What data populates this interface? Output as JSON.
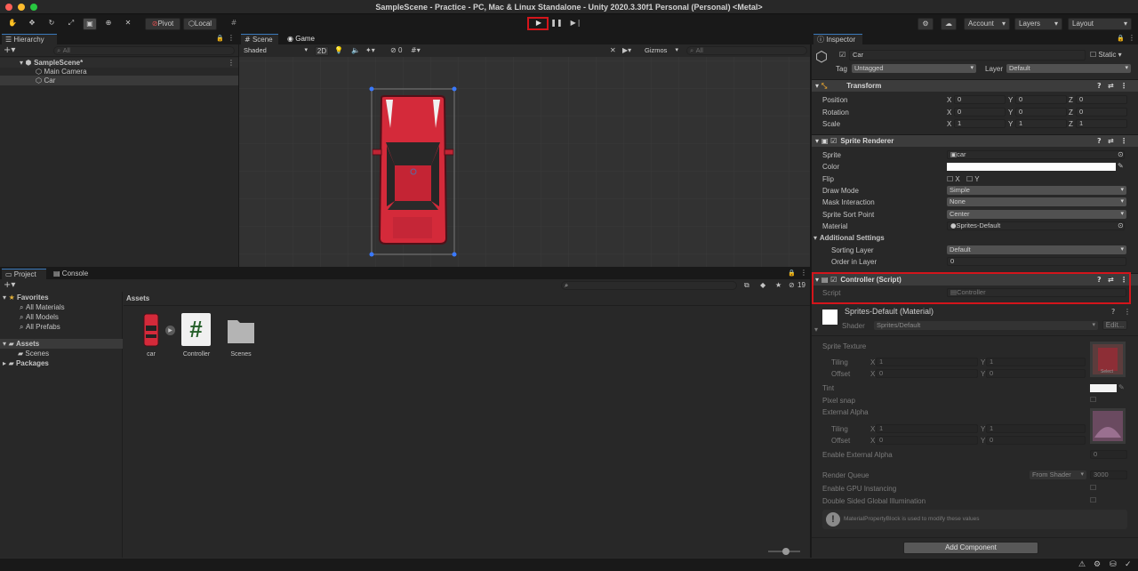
{
  "window": {
    "title": "SampleScene - Practice - PC, Mac & Linux Standalone - Unity 2020.3.30f1 Personal (Personal) <Metal>"
  },
  "toolbar": {
    "pivot": "Pivot",
    "local": "Local",
    "account": "Account",
    "layers": "Layers",
    "layout": "Layout"
  },
  "hierarchy": {
    "tab": "Hierarchy",
    "search": "All",
    "scene": "SampleScene*",
    "items": [
      "Main Camera",
      "Car"
    ]
  },
  "scene_view": {
    "tabs": [
      "Scene",
      "Game"
    ],
    "shading": "Shaded",
    "mode2d": "2D",
    "hidden_count": "0",
    "gizmos": "Gizmos",
    "search": "All"
  },
  "project": {
    "tabs": [
      "Project",
      "Console"
    ],
    "count": "19",
    "favorites": {
      "label": "Favorites",
      "items": [
        "All Materials",
        "All Models",
        "All Prefabs"
      ]
    },
    "tree": {
      "assets": "Assets",
      "scenes": "Scenes",
      "packages": "Packages"
    },
    "breadcrumb": "Assets",
    "assets": [
      "car",
      "Controller",
      "Scenes"
    ]
  },
  "inspector": {
    "tab": "Inspector",
    "name": "Car",
    "static": "Static",
    "tag_label": "Tag",
    "tag": "Untagged",
    "layer_label": "Layer",
    "layer": "Default",
    "transform": {
      "title": "Transform",
      "rows": [
        {
          "label": "Position",
          "x": "0",
          "y": "0",
          "z": "0"
        },
        {
          "label": "Rotation",
          "x": "0",
          "y": "0",
          "z": "0"
        },
        {
          "label": "Scale",
          "x": "1",
          "y": "1",
          "z": "1"
        }
      ],
      "axes": [
        "X",
        "Y",
        "Z"
      ]
    },
    "sprite_renderer": {
      "title": "Sprite Renderer",
      "labels": {
        "sprite": "Sprite",
        "color": "Color",
        "flip": "Flip",
        "draw_mode": "Draw Mode",
        "mask": "Mask Interaction",
        "sort_point": "Sprite Sort Point",
        "material": "Material",
        "additional": "Additional Settings",
        "sorting_layer": "Sorting Layer",
        "order": "Order in Layer"
      },
      "sprite": "car",
      "flip_x": "X",
      "flip_y": "Y",
      "draw_mode": "Simple",
      "mask": "None",
      "sort_point": "Center",
      "material": "Sprites-Default",
      "sorting_layer": "Default",
      "order": "0"
    },
    "controller": {
      "title": "Controller (Script)",
      "script_label": "Script",
      "script": "Controller"
    },
    "material": {
      "title": "Sprites-Default (Material)",
      "shader_label": "Shader",
      "shader": "Sprites/Default",
      "edit": "Edit...",
      "sprite_texture": "Sprite Texture",
      "tiling": "Tiling",
      "offset": "Offset",
      "tiling_x": "1",
      "tiling_y": "1",
      "offset_x": "0",
      "offset_y": "0",
      "select": "Select",
      "tint": "Tint",
      "pixel_snap": "Pixel snap",
      "external_alpha": "External Alpha",
      "enable_external_alpha": "Enable External Alpha",
      "enable_external_alpha_value": "0",
      "render_queue": "Render Queue",
      "render_queue_mode": "From Shader",
      "render_queue_value": "3000",
      "gpu_instancing": "Enable GPU Instancing",
      "double_sided": "Double Sided Global Illumination",
      "info": "MaterialPropertyBlock is used to modify these values"
    },
    "add_component": "Add Component"
  },
  "colors": {
    "accent": "#3a79bb",
    "highlight": "#d3151b",
    "car": "#d42a3a"
  }
}
